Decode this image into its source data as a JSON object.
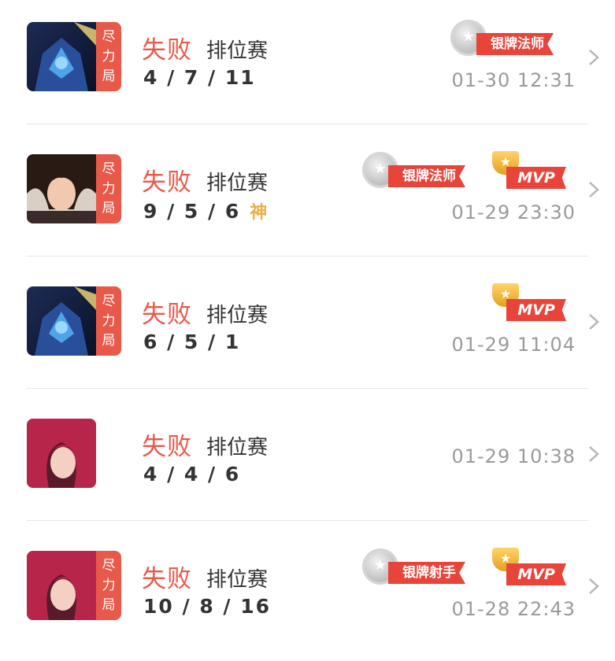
{
  "matches": [
    {
      "hero": "hero-blue-warrior-portrait",
      "tag": [
        "尽",
        "力",
        "局"
      ],
      "result": "失败",
      "mode": "排位赛",
      "kda": "4 / 7 / 11",
      "god": "",
      "badge": "银牌法师",
      "mvp": "",
      "time": "01-30 12:31"
    },
    {
      "hero": "hero-dark-hair-woman-portrait",
      "tag": [
        "尽",
        "力",
        "局"
      ],
      "result": "失败",
      "mode": "排位赛",
      "kda": "9 / 5 / 6",
      "god": "神",
      "badge": "银牌法师",
      "mvp": "MVP",
      "time": "01-29 23:30"
    },
    {
      "hero": "hero-blue-warrior-portrait",
      "tag": [
        "尽",
        "力",
        "局"
      ],
      "result": "失败",
      "mode": "排位赛",
      "kda": "6 / 5 / 1",
      "god": "",
      "badge": "",
      "mvp": "MVP",
      "time": "01-29 11:04"
    },
    {
      "hero": "hero-pink-hair-woman-portrait",
      "tag": [],
      "result": "失败",
      "mode": "排位赛",
      "kda": "4 / 4 / 6",
      "god": "",
      "badge": "",
      "mvp": "",
      "time": "01-29 10:38"
    },
    {
      "hero": "hero-pink-hair-woman-portrait",
      "tag": [
        "尽",
        "力",
        "局"
      ],
      "result": "失败",
      "mode": "排位赛",
      "kda": "10 / 8 / 16",
      "god": "",
      "badge": "银牌射手",
      "mvp": "MVP",
      "time": "01-28 22:43"
    }
  ],
  "colors": {
    "result_red": "#e8594a",
    "badge_red": "#e8443a",
    "time_gray": "#9a9a9a",
    "god_gold": "#e8b048"
  }
}
